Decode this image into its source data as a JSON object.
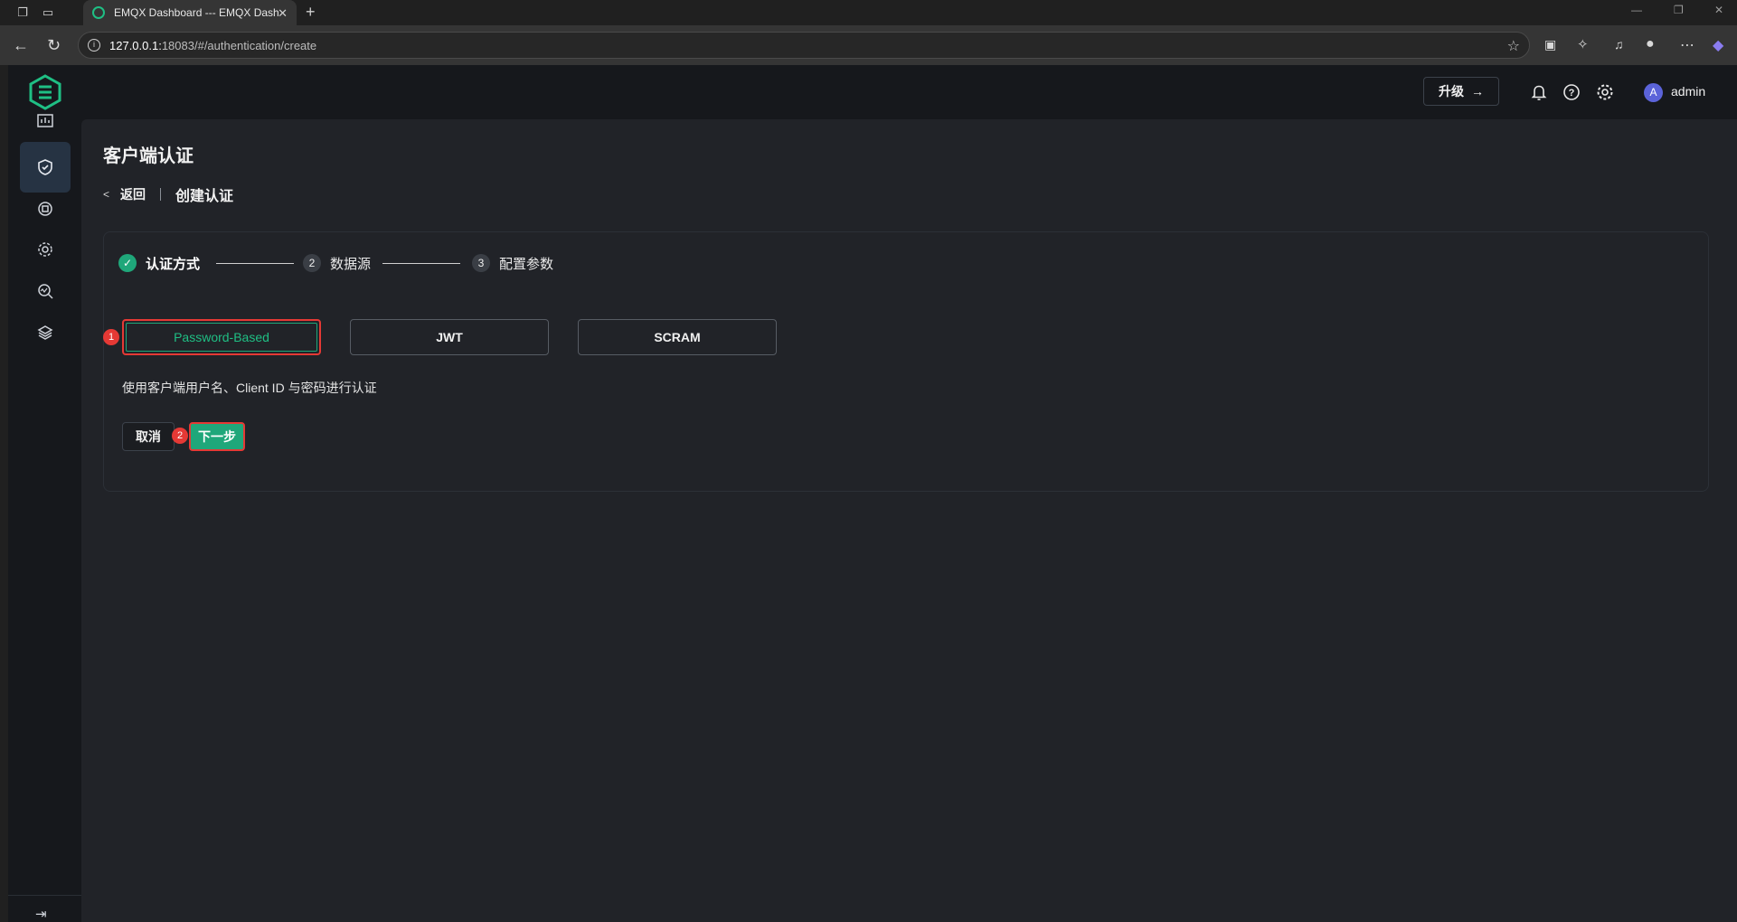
{
  "browser": {
    "tab_title": "EMQX Dashboard --- EMQX Dashboard",
    "url_host": "127.0.0.1:",
    "url_rest": "18083/#/authentication/create"
  },
  "header": {
    "upgrade_label": "升级",
    "user_initial": "A",
    "username": "admin"
  },
  "sidebar": {
    "items": [
      "monitoring",
      "access-control",
      "integration",
      "management",
      "diagnose",
      "system"
    ]
  },
  "page": {
    "title": "客户端认证",
    "back_label": "返回",
    "breadcrumb_title": "创建认证"
  },
  "steps": [
    {
      "num": "✓",
      "label": "认证方式",
      "status": "done"
    },
    {
      "num": "2",
      "label": "数据源",
      "status": "pending"
    },
    {
      "num": "3",
      "label": "配置参数",
      "status": "pending"
    }
  ],
  "auth_types": [
    {
      "label": "Password-Based",
      "selected": true
    },
    {
      "label": "JWT",
      "selected": false
    },
    {
      "label": "SCRAM",
      "selected": false
    }
  ],
  "description": "使用客户端用户名、Client ID 与密码进行认证",
  "actions": {
    "cancel_label": "取消",
    "next_label": "下一步"
  },
  "markers": [
    "1",
    "2"
  ],
  "colors": {
    "accent": "#1fa77a",
    "highlight": "#e53935",
    "background": "#16181c"
  }
}
